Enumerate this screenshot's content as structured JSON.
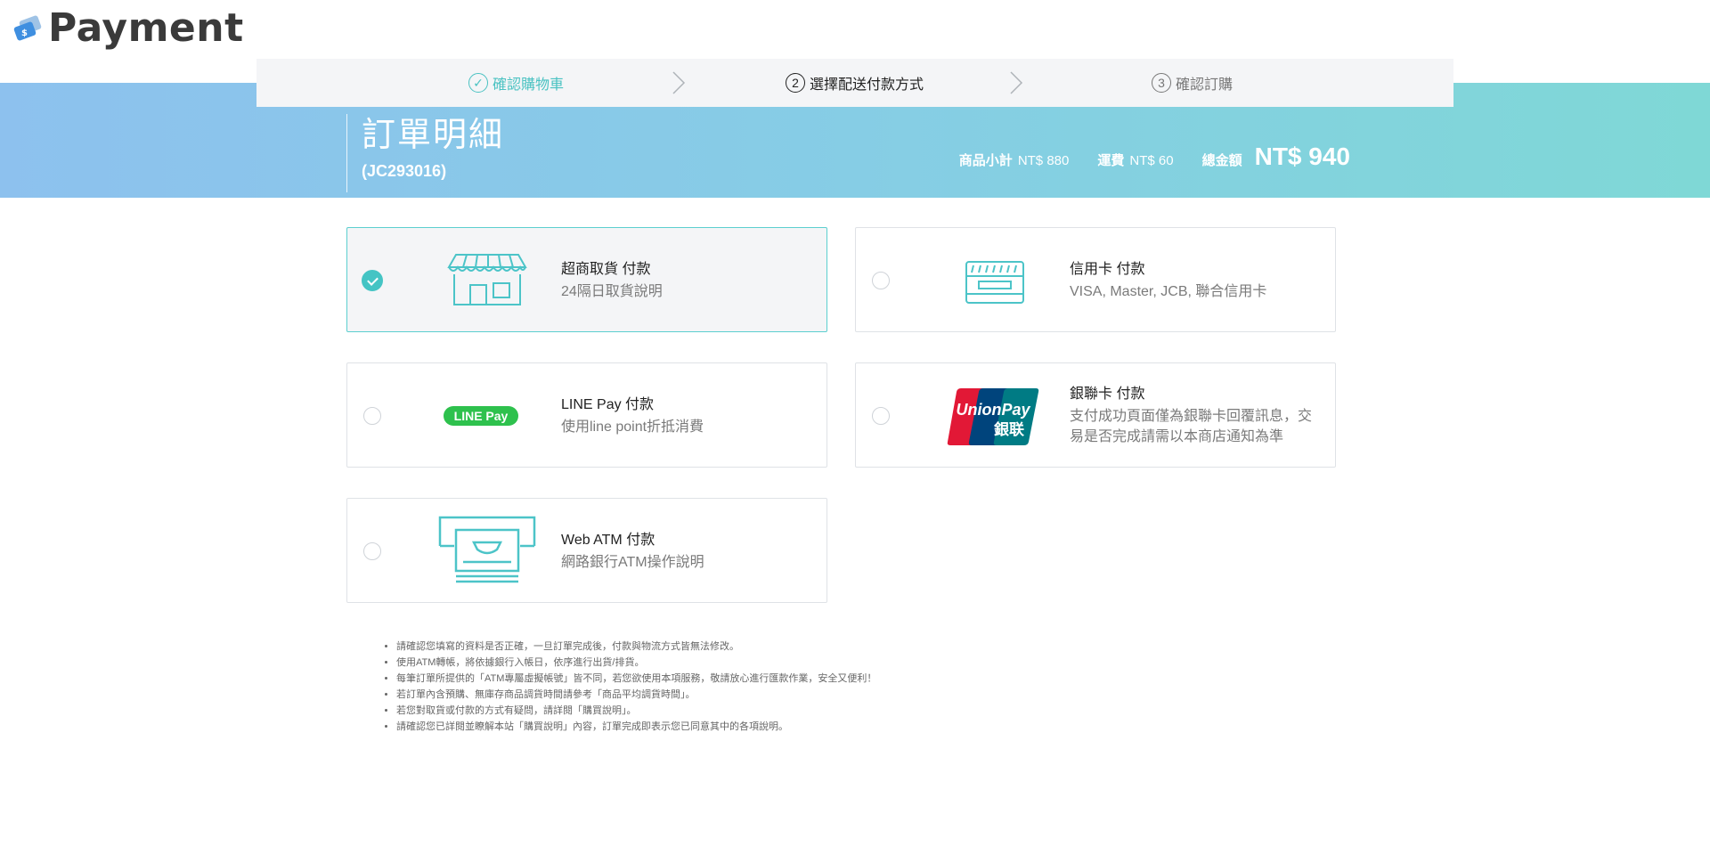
{
  "brand": {
    "name": "Payment",
    "icon": "card-dollar-icon"
  },
  "steps": [
    {
      "number": "✓",
      "label": "確認購物車",
      "state": "done"
    },
    {
      "number": "2",
      "label": "選擇配送付款方式",
      "state": "current"
    },
    {
      "number": "3",
      "label": "確認訂購",
      "state": "pending"
    }
  ],
  "order": {
    "title": "訂單明細",
    "number": "(JC293016)",
    "subtotal_label": "商品小計",
    "subtotal_value": "NT$ 880",
    "shipping_label": "運費",
    "shipping_value": "NT$ 60",
    "total_label": "總金額",
    "total_value": "NT$ 940"
  },
  "payment_methods": [
    {
      "name": "超商取貨 付款",
      "desc": "24隔日取貨說明",
      "icon": "store-icon",
      "selected": true
    },
    {
      "name": "信用卡 付款",
      "desc": "VISA, Master, JCB, 聯合信用卡",
      "icon": "credit-card-icon",
      "selected": false
    },
    {
      "name": "LINE Pay 付款",
      "desc": "使用line point折抵消費",
      "icon": "line-pay-logo",
      "logo_text": "LINE Pay",
      "selected": false
    },
    {
      "name": "銀聯卡 付款",
      "desc": "支付成功頁面僅為銀聯卡回覆訊息，交易是否完成請需以本商店通知為準",
      "icon": "unionpay-logo",
      "logo_text_en": "UnionPay",
      "logo_text_zh": "銀联",
      "selected": false
    },
    {
      "name": "Web ATM 付款",
      "desc": "網路銀行ATM操作說明",
      "icon": "atm-icon",
      "selected": false
    }
  ],
  "notes": [
    "請確認您填寫的資料是否正確，一旦訂單完成後，付款與物流方式皆無法修改。",
    "使用ATM轉帳，將依據銀行入帳日，依序進行出貨/排貨。",
    "每筆訂單所提供的「ATM專屬虛擬帳號」皆不同，若您欲使用本項服務，敬請放心進行匯款作業，安全又便利！",
    "若訂單內含預購、無庫存商品調貨時間請參考「商品平均調貨時間」。",
    "若您對取貨或付款的方式有疑問，請詳閱「購買說明」。",
    "請確認您已詳閱並瞭解本站「購買說明」內容，訂單完成即表示您已同意其中的各項說明。"
  ],
  "colors": {
    "accent": "#44c4c4",
    "banner_start": "#8dc1ee",
    "banner_end": "#7fd8d6",
    "icon_teal": "#4cc4c8"
  }
}
